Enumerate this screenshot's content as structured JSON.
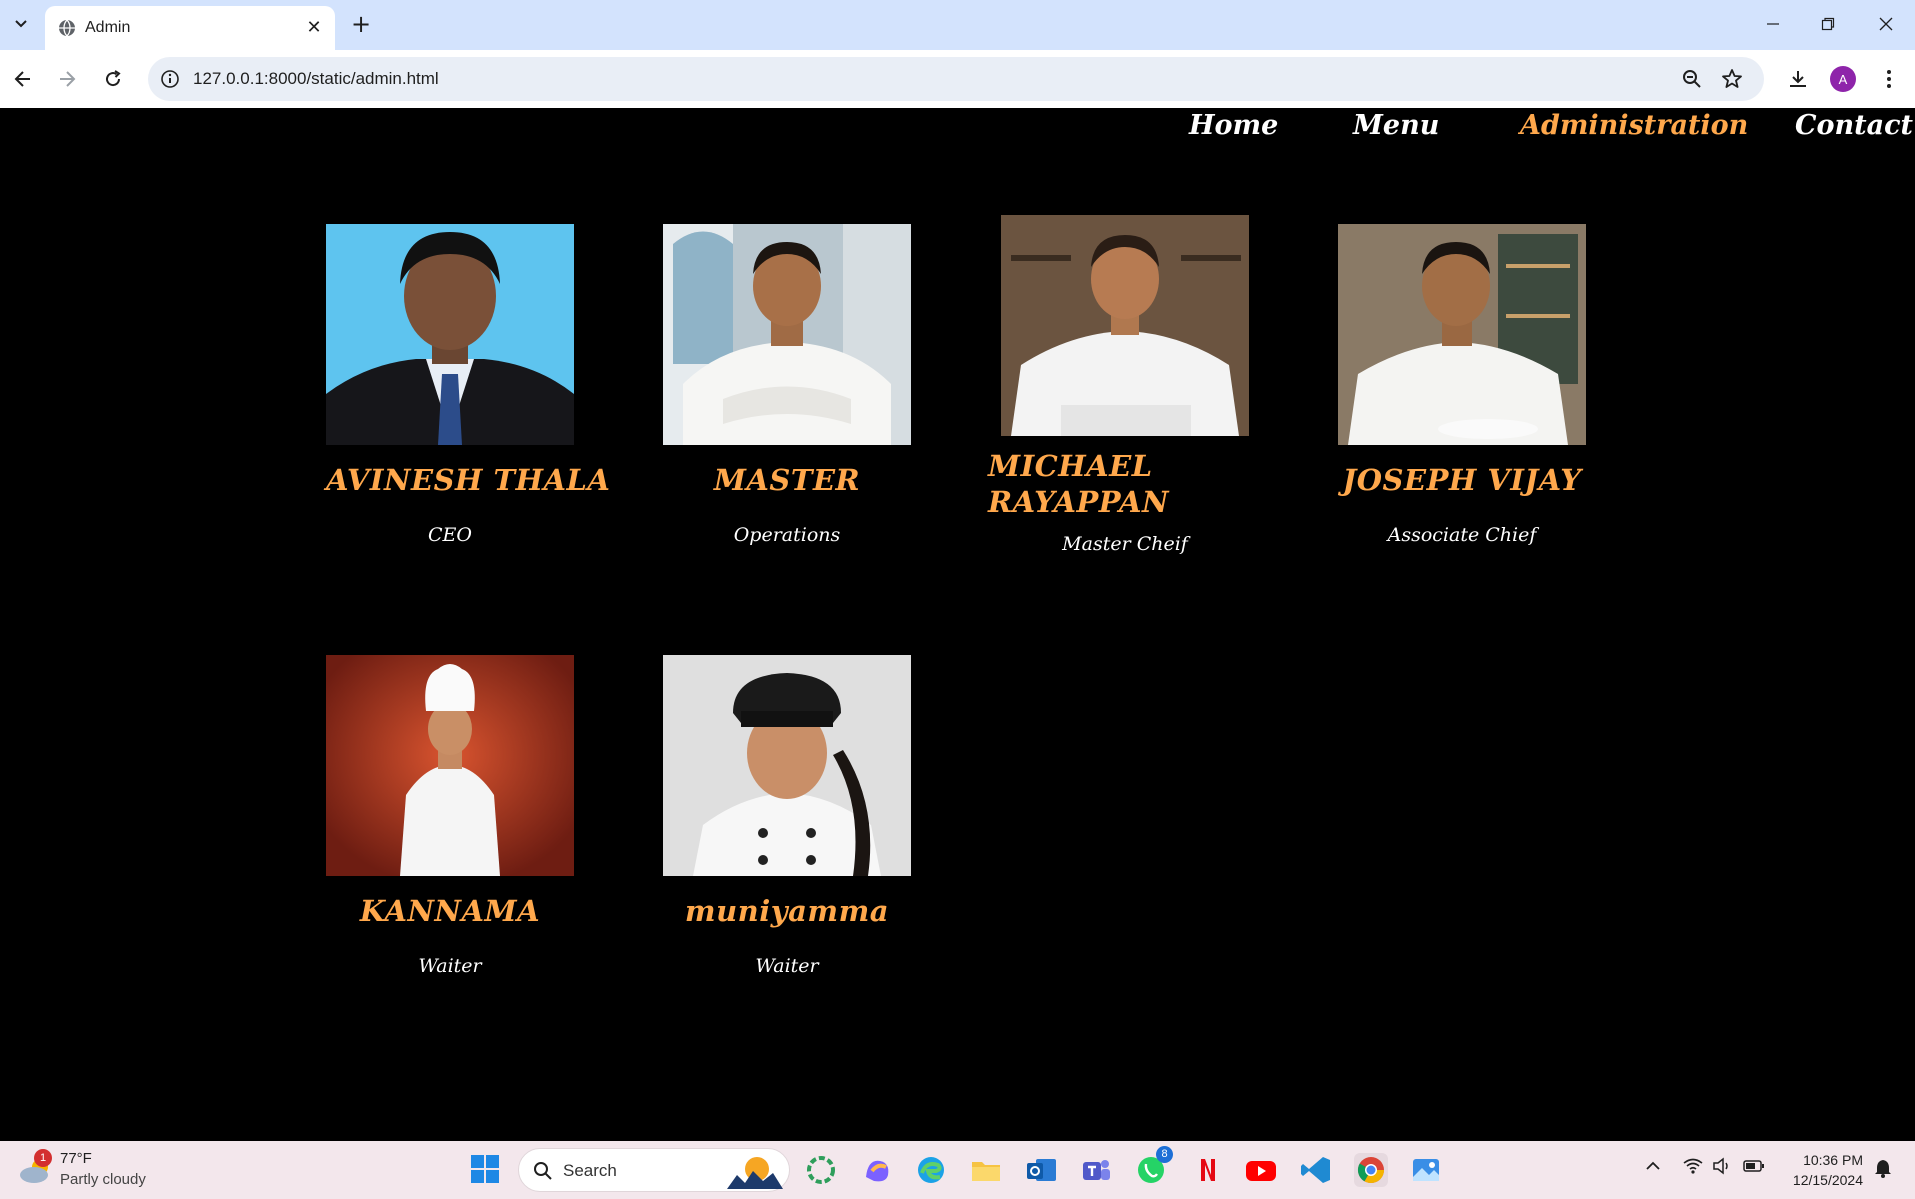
{
  "browser": {
    "tab_title": "Admin",
    "url": "127.0.0.1:8000/static/admin.html",
    "profile_initial": "A"
  },
  "nav": {
    "items": [
      {
        "label": "Home",
        "active": false
      },
      {
        "label": "Menu",
        "active": false
      },
      {
        "label": "Administration",
        "active": true
      },
      {
        "label": "Contact us",
        "active": false
      }
    ]
  },
  "staff": [
    {
      "name": "AVINESH THALA",
      "role": "CEO"
    },
    {
      "name": "MASTER",
      "role": "Operations"
    },
    {
      "name": "MICHAEL RAYAPPAN",
      "role": "Master Cheif"
    },
    {
      "name": "JOSEPH VIJAY",
      "role": "Associate Chief"
    },
    {
      "name": "KANNAMA",
      "role": "Waiter"
    },
    {
      "name": "muniyamma",
      "role": "Waiter"
    }
  ],
  "taskbar": {
    "weather_temp": "77°F",
    "weather_desc": "Partly cloudy",
    "weather_badge": "1",
    "search_placeholder": "Search",
    "whatsapp_badge": "8",
    "time": "10:36 PM",
    "date": "12/15/2024"
  },
  "colors": {
    "accent": "#ffa84c",
    "page_bg": "#000000",
    "tabstrip_bg": "#d3e3fd"
  }
}
